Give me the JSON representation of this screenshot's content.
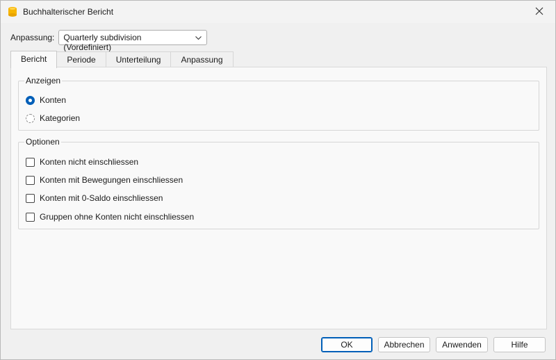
{
  "window": {
    "title": "Buchhalterischer Bericht",
    "icon": "banana-app-icon",
    "accent_color": "#005fb8"
  },
  "customization": {
    "label": "Anpassung:",
    "selected": "Quarterly subdivision (Vordefiniert)"
  },
  "tabs": [
    {
      "label": "Bericht",
      "active": true
    },
    {
      "label": "Periode",
      "active": false
    },
    {
      "label": "Unterteilung",
      "active": false
    },
    {
      "label": "Anpassung",
      "active": false
    }
  ],
  "show_group": {
    "title": "Anzeigen",
    "options": [
      {
        "label": "Konten",
        "checked": true
      },
      {
        "label": "Kategorien",
        "checked": false
      }
    ]
  },
  "options_group": {
    "title": "Optionen",
    "items": [
      {
        "label": "Konten nicht einschliessen",
        "checked": false
      },
      {
        "label": "Konten mit Bewegungen einschliessen",
        "checked": false
      },
      {
        "label": "Konten mit 0-Saldo einschliessen",
        "checked": false
      },
      {
        "label": "Gruppen ohne Konten nicht einschliessen",
        "checked": false
      }
    ]
  },
  "buttons": {
    "ok": "OK",
    "cancel": "Abbrechen",
    "apply": "Anwenden",
    "help": "Hilfe"
  }
}
